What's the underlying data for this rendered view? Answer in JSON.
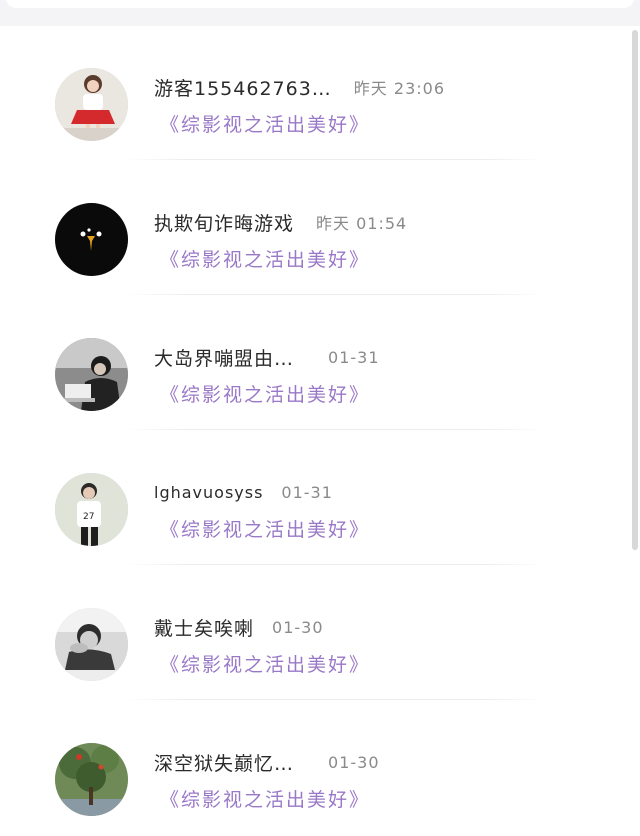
{
  "conversations": [
    {
      "name": "游客155462763…",
      "time": "昨天 23:06",
      "subtitle": "《综影视之活出美好》",
      "avatar": "girl-red-skirt-avatar"
    },
    {
      "name": "执欺旬诈晦游戏",
      "time": "昨天 01:54",
      "subtitle": "《综影视之活出美好》",
      "avatar": "black-creature-avatar"
    },
    {
      "name": "大岛界嘣盟由…",
      "time": "01-31",
      "subtitle": "《综影视之活出美好》",
      "avatar": "man-at-laptop-avatar"
    },
    {
      "name": "lghavuosyss",
      "time": "01-31",
      "subtitle": "《综影视之活出美好》",
      "avatar": "boy-jersey-27-avatar"
    },
    {
      "name": "戴士矣唉喇",
      "time": "01-30",
      "subtitle": "《综影视之活出美好》",
      "avatar": "boy-hand-face-avatar"
    },
    {
      "name": "深空狱失巅忆…",
      "time": "01-30",
      "subtitle": "《综影视之活出美好》",
      "avatar": "tree-photo-avatar"
    }
  ],
  "colors": {
    "subtitle": "#9a78c8",
    "name": "#2b2b2b",
    "time": "#8a8a8a",
    "background": "#ffffff"
  }
}
